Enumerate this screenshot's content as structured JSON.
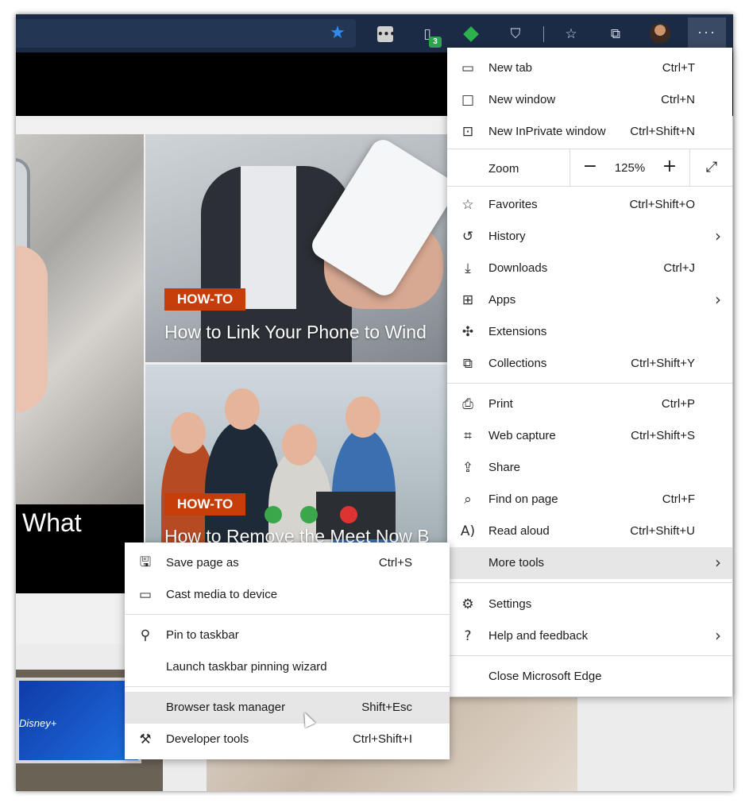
{
  "toolbar": {
    "favorite_star": "star-filled-icon",
    "extension_badge": "3",
    "menu_button": "···"
  },
  "page": {
    "left_caption": "What",
    "card_top": {
      "tag": "HOW-TO",
      "headline": "How to Link Your Phone to Wind"
    },
    "card_mid": {
      "tag": "HOW-TO",
      "headline": "How to Remove the Meet Now B"
    },
    "tv_text": "Disney+"
  },
  "main_menu": {
    "new_tab": {
      "label": "New tab",
      "shortcut": "Ctrl+T"
    },
    "new_window": {
      "label": "New window",
      "shortcut": "Ctrl+N"
    },
    "new_inprivate": {
      "label": "New InPrivate window",
      "shortcut": "Ctrl+Shift+N"
    },
    "zoom": {
      "label": "Zoom",
      "minus": "−",
      "value": "125%",
      "plus": "+"
    },
    "favorites": {
      "label": "Favorites",
      "shortcut": "Ctrl+Shift+O"
    },
    "history": {
      "label": "History"
    },
    "downloads": {
      "label": "Downloads",
      "shortcut": "Ctrl+J"
    },
    "apps": {
      "label": "Apps"
    },
    "extensions": {
      "label": "Extensions"
    },
    "collections": {
      "label": "Collections",
      "shortcut": "Ctrl+Shift+Y"
    },
    "print": {
      "label": "Print",
      "shortcut": "Ctrl+P"
    },
    "web_capture": {
      "label": "Web capture",
      "shortcut": "Ctrl+Shift+S"
    },
    "share": {
      "label": "Share"
    },
    "find_on_page": {
      "label": "Find on page",
      "shortcut": "Ctrl+F"
    },
    "read_aloud": {
      "label": "Read aloud",
      "shortcut": "Ctrl+Shift+U"
    },
    "more_tools": {
      "label": "More tools"
    },
    "settings": {
      "label": "Settings"
    },
    "help_feedback": {
      "label": "Help and feedback"
    },
    "close_edge": {
      "label": "Close Microsoft Edge"
    }
  },
  "sub_menu": {
    "save_page_as": {
      "label": "Save page as",
      "shortcut": "Ctrl+S"
    },
    "cast_media": {
      "label": "Cast media to device"
    },
    "pin_taskbar": {
      "label": "Pin to taskbar"
    },
    "launch_pin_wizard": {
      "label": "Launch taskbar pinning wizard"
    },
    "task_manager": {
      "label": "Browser task manager",
      "shortcut": "Shift+Esc"
    },
    "developer_tools": {
      "label": "Developer tools",
      "shortcut": "Ctrl+Shift+I"
    }
  },
  "colors": {
    "toolbar_bg": "#1c2b45",
    "tag_bg": "#c73d09",
    "highlight": "#e6e6e6",
    "star": "#2f8cf0"
  }
}
